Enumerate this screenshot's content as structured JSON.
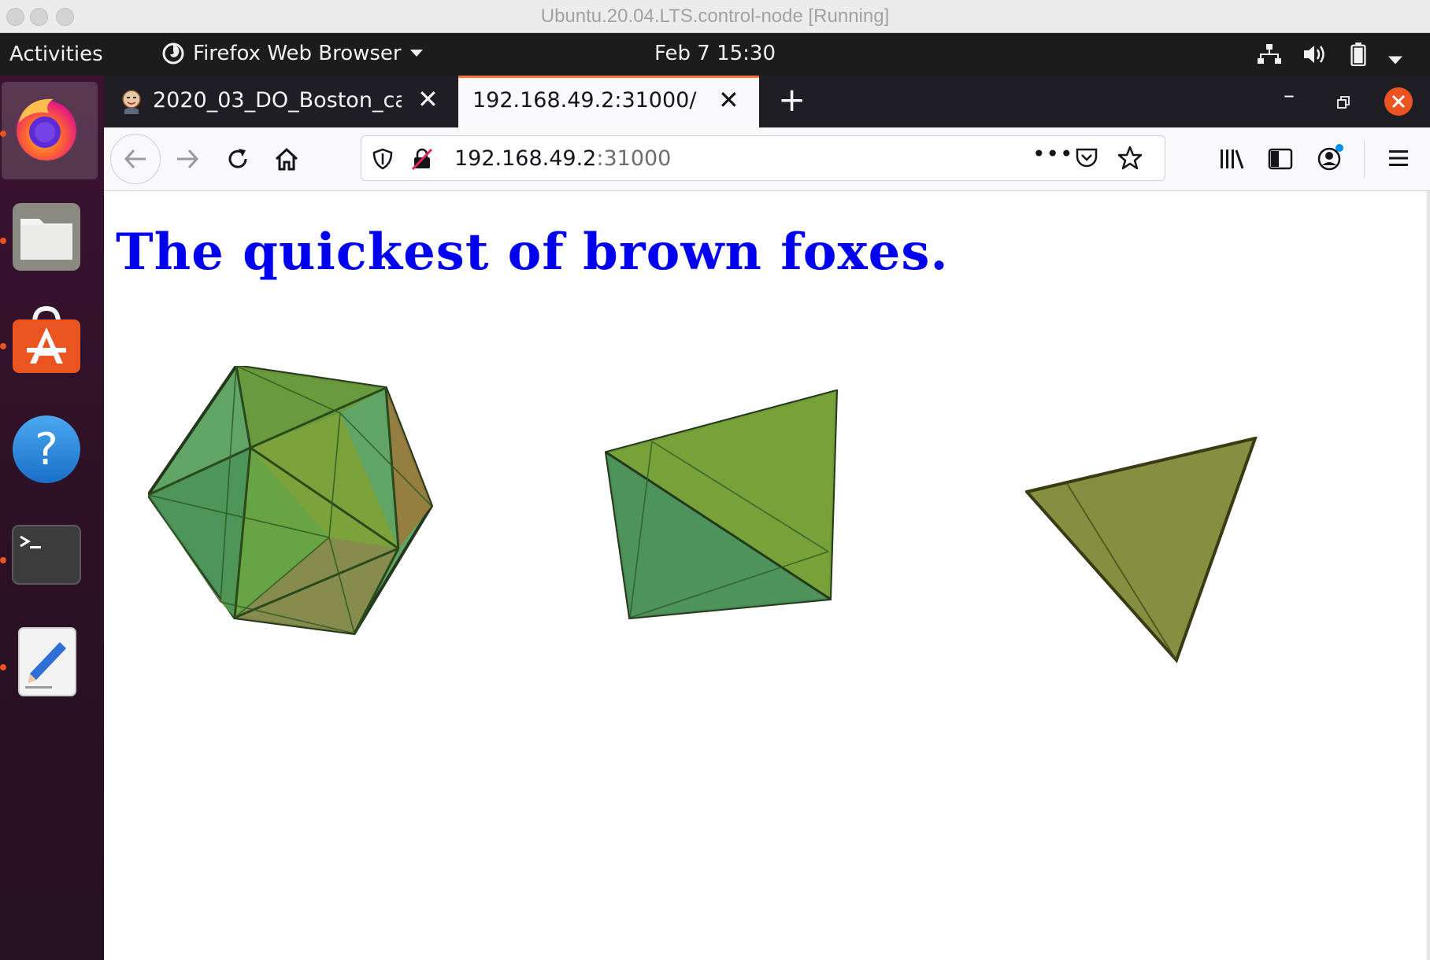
{
  "vm_window": {
    "title": "Ubuntu.20.04.LTS.control-node [Running]"
  },
  "topbar": {
    "activities_label": "Activities",
    "app_menu_label": "Firefox Web Browser",
    "clock": "Feb 7  15:30",
    "tray_icons": [
      "network-icon",
      "volume-icon",
      "battery-icon",
      "system-menu-chevron-icon"
    ]
  },
  "dock": {
    "apps": [
      {
        "name": "Firefox",
        "icon": "firefox-icon",
        "running": true
      },
      {
        "name": "Files",
        "icon": "files-icon",
        "running": true
      },
      {
        "name": "Ubuntu Software",
        "icon": "ubuntu-software-icon",
        "running": true
      },
      {
        "name": "Help",
        "icon": "help-icon",
        "running": false
      },
      {
        "name": "Terminal",
        "icon": "terminal-icon",
        "running": true
      },
      {
        "name": "Text Editor",
        "icon": "text-editor-icon",
        "running": true
      }
    ]
  },
  "browser": {
    "tabs": [
      {
        "label": "2020_03_DO_Boston_ca",
        "active": false
      },
      {
        "label": "192.168.49.2:31000/",
        "active": true
      }
    ],
    "url": {
      "host": "192.168.49.2",
      "port": ":31000"
    }
  },
  "page": {
    "heading": "The quickest of brown foxes.",
    "shapes": [
      "icosahedron",
      "octahedron",
      "tetrahedron"
    ]
  },
  "colors": {
    "accent": "#e95420",
    "heading": "#0000ee",
    "tab_highlight": "#ff7139",
    "close_button": "#e95420"
  }
}
